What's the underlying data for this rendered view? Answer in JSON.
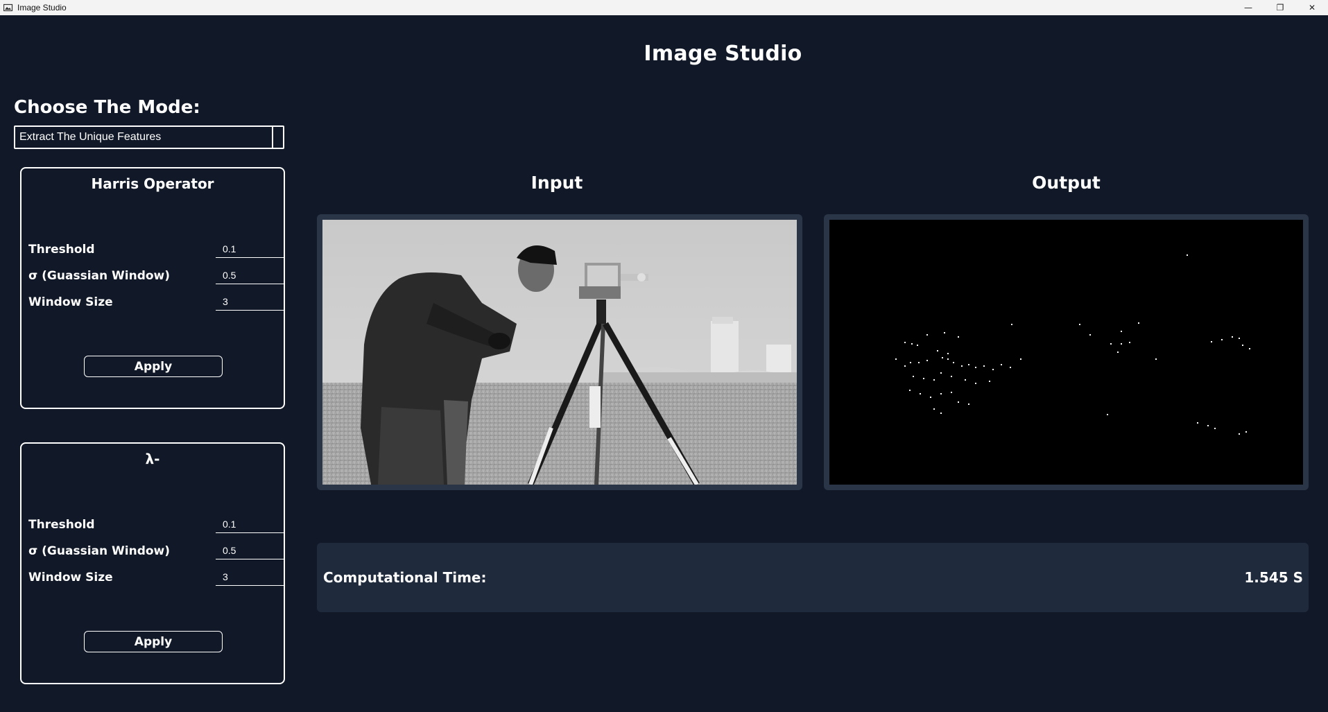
{
  "window": {
    "title": "Image Studio",
    "controls": {
      "minimize": "—",
      "restore": "❐",
      "close": "✕"
    }
  },
  "header": {
    "title": "Image Studio"
  },
  "mode": {
    "label": "Choose The Mode:",
    "selected": "Extract The Unique Features"
  },
  "panels": [
    {
      "title": "Harris Operator",
      "threshold_label": "Threshold",
      "threshold_value": "0.1",
      "sigma_label": "σ (Guassian Window)",
      "sigma_value": "0.5",
      "window_label": "Window Size",
      "window_value": "3",
      "apply_label": "Apply"
    },
    {
      "title": "λ-",
      "threshold_label": "Threshold",
      "threshold_value": "0.1",
      "sigma_label": "σ (Guassian Window)",
      "sigma_value": "0.5",
      "window_label": "Window Size",
      "window_value": "3",
      "apply_label": "Apply"
    }
  ],
  "viewer": {
    "input_title": "Input",
    "output_title": "Output"
  },
  "status": {
    "time_label": "Computational Time:",
    "time_value": "1.545 S"
  },
  "colors": {
    "background": "#111827",
    "frame": "#2a3647",
    "status_bar": "#1f2a3c",
    "text": "#ffffff"
  }
}
